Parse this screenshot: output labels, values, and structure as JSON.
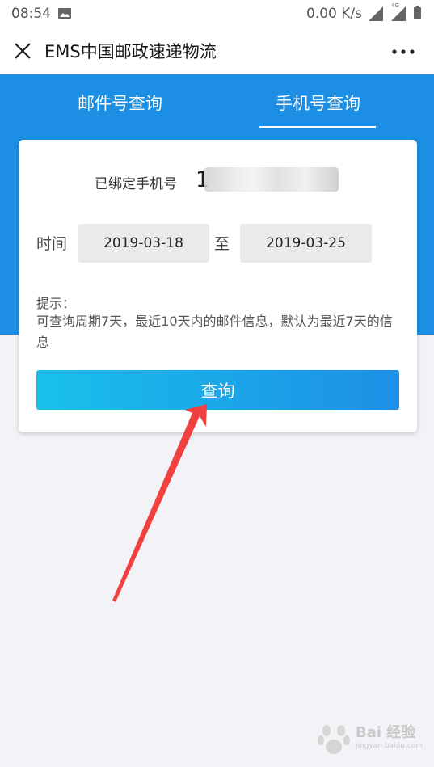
{
  "status_bar": {
    "time": "08:54",
    "network_speed": "0.00 K/s",
    "network_type": "4G"
  },
  "title_bar": {
    "title": "EMS中国邮政速递物流"
  },
  "tabs": [
    {
      "label": "邮件号查询",
      "active": false
    },
    {
      "label": "手机号查询",
      "active": true
    }
  ],
  "form": {
    "bound_phone_label": "已绑定手机号",
    "bound_phone_visible_prefix": "1",
    "time_label": "时间",
    "date_start": "2019-03-18",
    "date_separator": "至",
    "date_end": "2019-03-25",
    "tip_title": "提示：",
    "tip_text": "可查询周期7天，最近10天内的邮件信息，默认为最近7天的信息",
    "query_button": "查询"
  },
  "watermark": {
    "brand": "Bai 经验",
    "url": "jingyan.baidu.com"
  },
  "colors": {
    "header_blue": "#1c8fe4",
    "button_gradient_start": "#19c1ea",
    "button_gradient_end": "#1f8fe6",
    "annotation_arrow": "#f04040",
    "page_background": "#f3f3f7"
  },
  "icons": [
    "photo-icon",
    "signal-icon",
    "battery-icon",
    "close-icon",
    "more-icon",
    "annotation-arrow",
    "baidu-paw-icon"
  ]
}
